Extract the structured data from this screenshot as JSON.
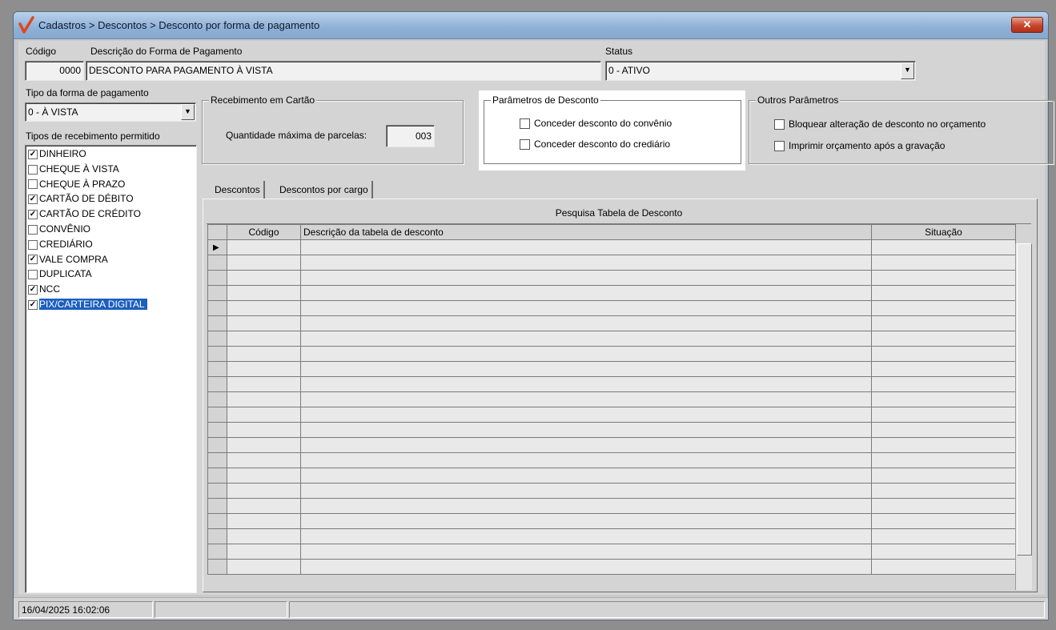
{
  "window": {
    "title": "Cadastros > Descontos > Desconto por forma de pagamento",
    "close_label": "✕"
  },
  "header": {
    "codigo_label": "Código",
    "codigo_value": "0000",
    "descricao_label": "Descrição do Forma de Pagamento",
    "descricao_value": "DESCONTO PARA PAGAMENTO À VISTA",
    "status_label": "Status",
    "status_value": "0 - ATIVO"
  },
  "tipo_forma": {
    "label": "Tipo da forma de pagamento",
    "value": "0 - À VISTA"
  },
  "tipos_recebimento": {
    "label": "Tipos de recebimento permitido",
    "items": [
      {
        "label": "DINHEIRO",
        "checked": true,
        "selected": false
      },
      {
        "label": "CHEQUE À VISTA",
        "checked": false,
        "selected": false
      },
      {
        "label": "CHEQUE À PRAZO",
        "checked": false,
        "selected": false
      },
      {
        "label": "CARTÃO DE DÉBITO",
        "checked": true,
        "selected": false
      },
      {
        "label": "CARTÃO DE CRÉDITO",
        "checked": true,
        "selected": false
      },
      {
        "label": "CONVÊNIO",
        "checked": false,
        "selected": false
      },
      {
        "label": "CREDIÁRIO",
        "checked": false,
        "selected": false
      },
      {
        "label": "VALE COMPRA",
        "checked": true,
        "selected": false
      },
      {
        "label": "DUPLICATA",
        "checked": false,
        "selected": false
      },
      {
        "label": "NCC",
        "checked": true,
        "selected": false
      },
      {
        "label": "PIX/CARTEIRA DIGITAL",
        "checked": true,
        "selected": true
      }
    ]
  },
  "recebimento_cartao": {
    "title": "Recebimento em Cartão",
    "parcelas_label": "Quantidade máxima de parcelas:",
    "parcelas_value": "003"
  },
  "parametros_desconto": {
    "title": "Parâmetros de Desconto",
    "options": [
      {
        "label": "Conceder desconto do convênio",
        "checked": false
      },
      {
        "label": "Conceder desconto do crediário",
        "checked": false
      }
    ]
  },
  "outros_parametros": {
    "title": "Outros Parâmetros",
    "options": [
      {
        "label": "Bloquear alteração de desconto no orçamento",
        "checked": false
      },
      {
        "label": "Imprimir orçamento após a gravação",
        "checked": false
      }
    ]
  },
  "tabs": [
    {
      "label": "Descontos",
      "active": true
    },
    {
      "label": "Descontos por cargo",
      "active": false
    }
  ],
  "grid": {
    "title": "Pesquisa Tabela de Desconto",
    "columns": [
      "",
      "Código",
      "Descrição da tabela de desconto",
      "Situação"
    ],
    "row_count": 22,
    "current_row_marker": "▶"
  },
  "statusbar": {
    "datetime": "16/04/2025 16:02:06",
    "panel2": "",
    "panel3": ""
  },
  "colors": {
    "selection": "#1b5fbf",
    "titlebar": "#8fb0d6",
    "close_button": "#c7452b"
  }
}
